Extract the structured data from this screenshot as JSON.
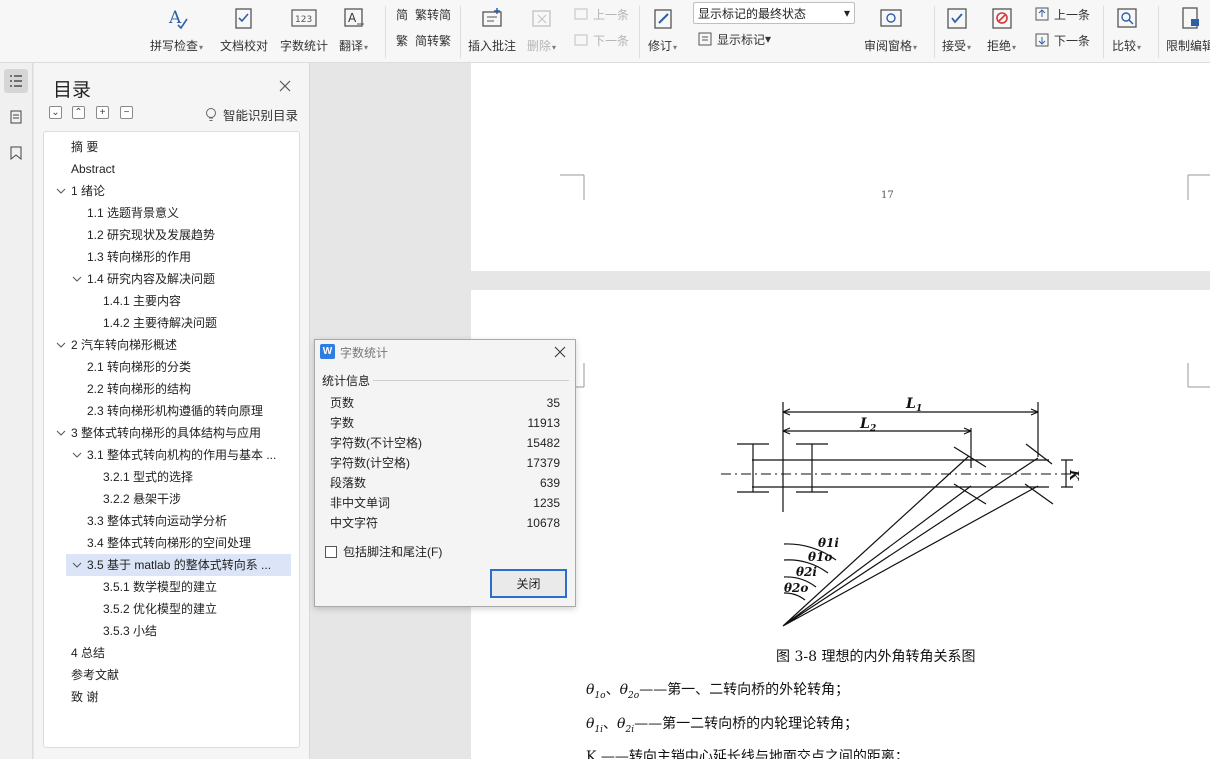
{
  "ribbon": {
    "spell_check": "拼写检查",
    "doc_proof": "文档校对",
    "word_count": "字数统计",
    "translate": "翻译",
    "trad_to_simp": "繁转简",
    "simp_to_trad": "简转繁",
    "insert_comment": "插入批注",
    "delete": "删除",
    "prev_comment": "上一条",
    "next_comment": "下一条",
    "revise": "修订",
    "markup_mode": "显示标记的最终状态",
    "show_markup": "显示标记",
    "review_pane": "审阅窗格",
    "accept": "接受",
    "reject": "拒绝",
    "prev_change": "上一条",
    "next_change": "下一条",
    "compare": "比较",
    "restrict_edit": "限制编辑"
  },
  "toc": {
    "title": "目录",
    "smart_label": "智能识别目录",
    "items": [
      {
        "label": "摘  要"
      },
      {
        "label": "Abstract"
      },
      {
        "label": "1 绪论"
      },
      {
        "label": "1.1  选题背景意义"
      },
      {
        "label": "1.2  研究现状及发展趋势"
      },
      {
        "label": "1.3  转向梯形的作用"
      },
      {
        "label": "1.4 研究内容及解决问题"
      },
      {
        "label": "1.4.1 主要内容"
      },
      {
        "label": "1.4.2 主要待解决问题"
      },
      {
        "label": "2 汽车转向梯形概述"
      },
      {
        "label": "2.1  转向梯形的分类"
      },
      {
        "label": "2.2  转向梯形的结构"
      },
      {
        "label": "2.3  转向梯形机构遵循的转向原理"
      },
      {
        "label": "3 整体式转向梯形的具体结构与应用"
      },
      {
        "label": "3.1  整体式转向机构的作用与基本 ..."
      },
      {
        "label": "3.2.1  型式的选择"
      },
      {
        "label": "3.2.2  悬架干涉"
      },
      {
        "label": "3.3  整体式转向运动学分析"
      },
      {
        "label": "3.4  整体式转向梯形的空间处理"
      },
      {
        "label": "3.5  基于 matlab 的整体式转向系 ..."
      },
      {
        "label": "3.5.1  数学模型的建立"
      },
      {
        "label": "3.5.2  优化模型的建立"
      },
      {
        "label": "3.5.3  小结"
      },
      {
        "label": "4 总结"
      },
      {
        "label": "参考文献"
      },
      {
        "label": "致    谢"
      }
    ]
  },
  "document": {
    "page_number": "17",
    "diagram_labels": {
      "L1": "L",
      "L1_sub": "1",
      "L2": "L",
      "L2_sub": "2",
      "K": "K",
      "t1i": "θ1i",
      "t1o": "θ1o",
      "t2i": "θ2i",
      "t2o": "θ2o"
    },
    "figure_caption": "图 3-8 理想的内外角转角关系图",
    "lines": [
      {
        "s1": "θ",
        "s1sub": "1o",
        "sep": "、",
        "s2": "θ",
        "s2sub": "2o",
        "text": "——第一、二转向桥的外轮转角；"
      },
      {
        "s1": "θ",
        "s1sub": "1i",
        "sep": "、",
        "s2": "θ",
        "s2sub": "2i",
        "text": "——第一二转向桥的内轮理论转角；"
      },
      {
        "text": "K ——转向主销中心延长线与地面交点之间的距离；"
      }
    ]
  },
  "word_count_dialog": {
    "title": "字数统计",
    "section": "统计信息",
    "rows": [
      {
        "label": "页数",
        "value": "35"
      },
      {
        "label": "字数",
        "value": "11913"
      },
      {
        "label": "字符数(不计空格)",
        "value": "15482"
      },
      {
        "label": "字符数(计空格)",
        "value": "17379"
      },
      {
        "label": "段落数",
        "value": "639"
      },
      {
        "label": "非中文单词",
        "value": "1235"
      },
      {
        "label": "中文字符",
        "value": "10678"
      }
    ],
    "include_notes": "包括脚注和尾注(F)",
    "close_button": "关闭"
  },
  "colors": {
    "accent": "#2c6fc9",
    "selection": "#dbe5f7",
    "app_icon": "#2e7de0"
  }
}
